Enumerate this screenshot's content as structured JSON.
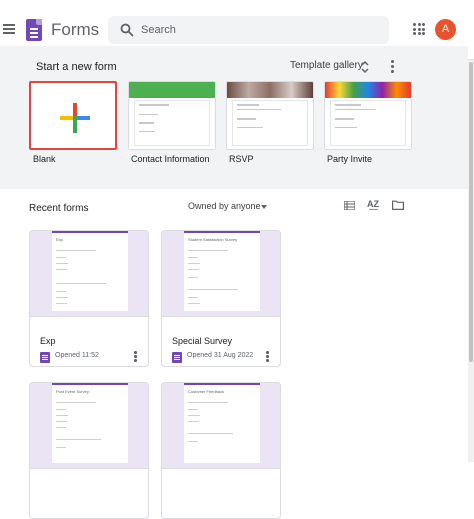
{
  "header": {
    "app_title": "Forms",
    "menu_icon": "hamburger-icon",
    "logo_icon": "forms-logo-icon",
    "search_placeholder": "Search",
    "apps_icon": "apps-grid-icon",
    "avatar_initial": "A",
    "avatar_color": "#e8532e"
  },
  "start": {
    "title": "Start a new form",
    "gallery_label": "Template gallery",
    "templates": [
      {
        "label": "Blank"
      },
      {
        "label": "Contact Information"
      },
      {
        "label": "RSVP"
      },
      {
        "label": "Party Invite"
      }
    ]
  },
  "recent": {
    "title": "Recent forms",
    "owner_filter": "Owned by anyone",
    "forms": [
      {
        "name": "Exp",
        "opened": "Opened 11:52",
        "thumb_title": "Exp"
      },
      {
        "name": "Special Survey",
        "opened": "Opened 31 Aug 2022",
        "thumb_title": "Student Satisfaction Survey"
      },
      {
        "name": "",
        "opened": "",
        "thumb_title": "Post Event Survey"
      },
      {
        "name": "",
        "opened": "",
        "thumb_title": "Customer Feedback"
      }
    ]
  },
  "colors": {
    "forms_purple": "#7248b9",
    "blank_border": "#e04540"
  }
}
